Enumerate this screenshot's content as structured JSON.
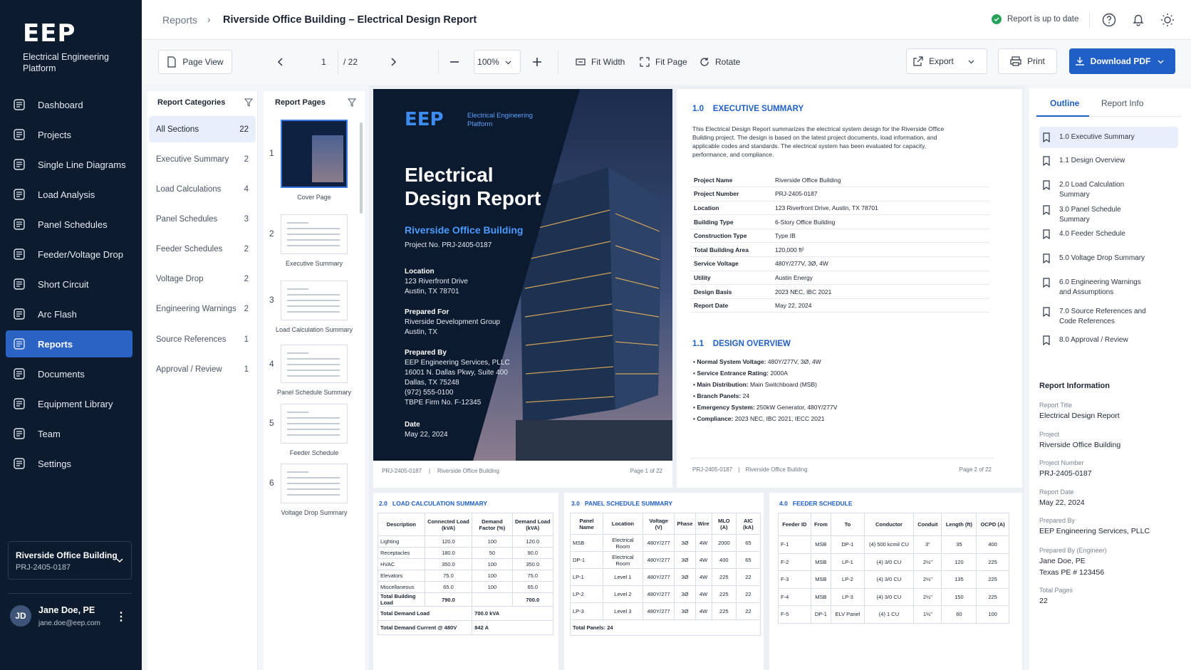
{
  "app": {
    "logo": "EEP",
    "subtitle": "Electrical Engineering Platform"
  },
  "nav": [
    {
      "label": "Dashboard",
      "icon": "home-icon"
    },
    {
      "label": "Projects",
      "icon": "folder-icon"
    },
    {
      "label": "Single Line Diagrams",
      "icon": "diagram-icon"
    },
    {
      "label": "Load Analysis",
      "icon": "chart-icon"
    },
    {
      "label": "Panel Schedules",
      "icon": "table-icon"
    },
    {
      "label": "Feeder/Voltage Drop",
      "icon": "line-chart-icon"
    },
    {
      "label": "Short Circuit",
      "icon": "spark-icon"
    },
    {
      "label": "Arc Flash",
      "icon": "flash-icon"
    },
    {
      "label": "Reports",
      "icon": "report-icon",
      "active": true
    },
    {
      "label": "Documents",
      "icon": "document-icon"
    },
    {
      "label": "Equipment Library",
      "icon": "library-icon"
    },
    {
      "label": "Team",
      "icon": "team-icon"
    },
    {
      "label": "Settings",
      "icon": "gear-icon"
    }
  ],
  "project": {
    "name": "Riverside Office Building",
    "number": "PRJ-2405-0187"
  },
  "user": {
    "initials": "JD",
    "name": "Jane Doe, PE",
    "email": "jane.doe@eep.com"
  },
  "breadcrumb": {
    "root": "Reports",
    "current": "Riverside Office Building – Electrical Design Report"
  },
  "status": {
    "text": "Report is up to date",
    "color": "#27a35a"
  },
  "toolbar": {
    "page_view": "Page View",
    "page": "1",
    "total": "/ 22",
    "zoom": "100%",
    "fit_width": "Fit Width",
    "fit_page": "Fit Page",
    "rotate": "Rotate",
    "export": "Export",
    "print": "Print",
    "download": "Download PDF"
  },
  "categories": {
    "title": "Report Categories",
    "items": [
      {
        "label": "All Sections",
        "count": "22",
        "active": true
      },
      {
        "label": "Executive Summary",
        "count": "2"
      },
      {
        "label": "Load Calculations",
        "count": "4"
      },
      {
        "label": "Panel Schedules",
        "count": "3"
      },
      {
        "label": "Feeder Schedules",
        "count": "2"
      },
      {
        "label": "Voltage Drop",
        "count": "2"
      },
      {
        "label": "Engineering Warnings",
        "count": "2"
      },
      {
        "label": "Source References",
        "count": "1"
      },
      {
        "label": "Approval / Review",
        "count": "1"
      }
    ]
  },
  "pages": {
    "title": "Report Pages",
    "items": [
      {
        "num": "1",
        "label": "Cover Page"
      },
      {
        "num": "2",
        "label": "Executive Summary"
      },
      {
        "num": "3",
        "label": "Load Calculation Summary"
      },
      {
        "num": "4",
        "label": "Panel Schedule Summary"
      },
      {
        "num": "5",
        "label": "Feeder Schedule"
      },
      {
        "num": "6",
        "label": "Voltage Drop Summary"
      }
    ]
  },
  "cover": {
    "logo": "EEP",
    "logo_sub1": "Electrical Engineering",
    "logo_sub2": "Platform",
    "title1": "Electrical",
    "title2": "Design Report",
    "project": "Riverside Office Building",
    "project_no": "Project No. PRJ-2405-0187",
    "location_h": "Location",
    "location": [
      "123 Riverfront Drive",
      "Austin, TX 78701"
    ],
    "prep_for_h": "Prepared For",
    "prep_for": [
      "Riverside Development Group",
      "Austin, TX"
    ],
    "prep_by_h": "Prepared By",
    "prep_by": [
      "EEP Engineering Services, PLLC",
      "16001 N. Dallas Pkwy, Suite 400",
      "Dallas, TX 75248",
      "(972) 555-0100",
      "TBPE Firm No. F-12345"
    ],
    "date_h": "Date",
    "date": "May 22, 2024",
    "foot_left": "PRJ-2405-0187",
    "foot_sep": "|",
    "foot_mid": "Riverside Office Building",
    "foot_right": "Page 1 of 22"
  },
  "exec": {
    "num": "1.0",
    "title": "EXECUTIVE SUMMARY",
    "para": "This Electrical Design Report summarizes the electrical system design for the Riverside Office Building project. The design is based on the latest project documents, load information, and applicable codes and standards. The electrical system has been evaluated for capacity, performance, and compliance.",
    "rows": [
      [
        "Project Name",
        "Riverside Office Building"
      ],
      [
        "Project Number",
        "PRJ-2405-0187"
      ],
      [
        "Location",
        "123 Riverfront Drive, Austin, TX 78701"
      ],
      [
        "Building Type",
        "6-Story Office Building"
      ],
      [
        "Construction Type",
        "Type IB"
      ],
      [
        "Total Building Area",
        "120,000 ft²"
      ],
      [
        "Service Voltage",
        "480Y/277V, 3Ø, 4W"
      ],
      [
        "Utility",
        "Austin Energy"
      ],
      [
        "Design Basis",
        "2023 NEC, IBC 2021"
      ],
      [
        "Report Date",
        "May 22, 2024"
      ]
    ],
    "overview_num": "1.1",
    "overview_title": "DESIGN OVERVIEW",
    "bullets": [
      [
        "Normal System Voltage:",
        "480Y/277V, 3Ø, 4W"
      ],
      [
        "Service Entrance Rating:",
        "2000A"
      ],
      [
        "Main Distribution:",
        "Main Switchboard (MSB)"
      ],
      [
        "Branch Panels:",
        "24"
      ],
      [
        "Emergency System:",
        "250kW Generator, 480Y/277V"
      ],
      [
        "Compliance:",
        "2023 NEC, IBC 2021, IECC 2021"
      ]
    ],
    "foot_left": "PRJ-2405-0187",
    "foot_sep": "|",
    "foot_mid": "Riverside Office Building",
    "foot_right": "Page 2 of 22"
  },
  "load_calc": {
    "num": "2.0",
    "title": "LOAD CALCULATION SUMMARY",
    "headers": [
      "Description",
      "Connected Load (kVA)",
      "Demand Factor (%)",
      "Demand Load (kVA)"
    ],
    "rows": [
      [
        "Lighting",
        "120.0",
        "100",
        "120.0"
      ],
      [
        "Receptacles",
        "180.0",
        "50",
        "90.0"
      ],
      [
        "HVAC",
        "350.0",
        "100",
        "350.0"
      ],
      [
        "Elevators",
        "75.0",
        "100",
        "75.0"
      ],
      [
        "Miscellaneous",
        "65.0",
        "100",
        "65.0"
      ]
    ],
    "total_building": [
      "Total Building Load",
      "790.0",
      "",
      "700.0"
    ],
    "total_demand": [
      "Total Demand Load",
      "700.0 kVA"
    ],
    "total_current": [
      "Total Demand Current @ 480V",
      "842 A"
    ]
  },
  "panel_sched": {
    "num": "3.0",
    "title": "PANEL SCHEDULE SUMMARY",
    "headers": [
      "Panel Name",
      "Location",
      "Voltage (V)",
      "Phase",
      "Wire",
      "MLO (A)",
      "AIC (kA)"
    ],
    "rows": [
      [
        "MSB",
        "Electrical Room",
        "480Y/277",
        "3Ø",
        "4W",
        "2000",
        "65"
      ],
      [
        "DP-1",
        "Electrical Room",
        "480Y/277",
        "3Ø",
        "4W",
        "400",
        "65"
      ],
      [
        "LP-1",
        "Level 1",
        "480Y/277",
        "3Ø",
        "4W",
        "225",
        "22"
      ],
      [
        "LP-2",
        "Level 2",
        "480Y/277",
        "3Ø",
        "4W",
        "225",
        "22"
      ],
      [
        "LP-3",
        "Level 3",
        "480Y/277",
        "3Ø",
        "4W",
        "225",
        "22"
      ]
    ],
    "total": "Total Panels: 24"
  },
  "feeder": {
    "num": "4.0",
    "title": "FEEDER SCHEDULE",
    "headers": [
      "Feeder ID",
      "From",
      "To",
      "Conductor",
      "Conduit",
      "Length (ft)",
      "OCPD (A)"
    ],
    "rows": [
      [
        "F-1",
        "MSB",
        "DP-1",
        "(4) 500 kcmil CU",
        "3\"",
        "35",
        "400"
      ],
      [
        "F-2",
        "MSB",
        "LP-1",
        "(4) 3/0 CU",
        "2½\"",
        "120",
        "225"
      ],
      [
        "F-3",
        "MSB",
        "LP-2",
        "(4) 3/0 CU",
        "2½\"",
        "135",
        "225"
      ],
      [
        "F-4",
        "MSB",
        "LP-3",
        "(4) 3/0 CU",
        "2½\"",
        "150",
        "225"
      ],
      [
        "F-5",
        "DP-1",
        "ELV Panel",
        "(4) 1 CU",
        "1½\"",
        "60",
        "100"
      ]
    ]
  },
  "right": {
    "tab_outline": "Outline",
    "tab_info": "Report Info",
    "outline": [
      {
        "label": "1.0 Executive Summary",
        "active": true
      },
      {
        "label": "1.1 Design Overview"
      },
      {
        "label": "2.0 Load Calculation Summary"
      },
      {
        "label": "3.0 Panel Schedule Summary"
      },
      {
        "label": "4.0 Feeder Schedule"
      },
      {
        "label": "5.0 Voltage Drop Summary"
      },
      {
        "label": "6.0 Engineering Warnings and Assumptions"
      },
      {
        "label": "7.0 Source References and Code References"
      },
      {
        "label": "8.0 Approval / Review"
      }
    ],
    "info_title": "Report Information",
    "info": [
      {
        "label": "Report Title",
        "value": [
          "Electrical Design Report"
        ]
      },
      {
        "label": "Project",
        "value": [
          "Riverside Office Building"
        ]
      },
      {
        "label": "Project Number",
        "value": [
          "PRJ-2405-0187"
        ]
      },
      {
        "label": "Report Date",
        "value": [
          "May 22, 2024"
        ]
      },
      {
        "label": "Prepared By",
        "value": [
          "EEP Engineering Services, PLLC"
        ]
      },
      {
        "label": "Prepared By (Engineer)",
        "value": [
          "Jane Doe, PE",
          "Texas PE # 123456"
        ]
      },
      {
        "label": "Total Pages",
        "value": [
          "22"
        ]
      }
    ]
  }
}
